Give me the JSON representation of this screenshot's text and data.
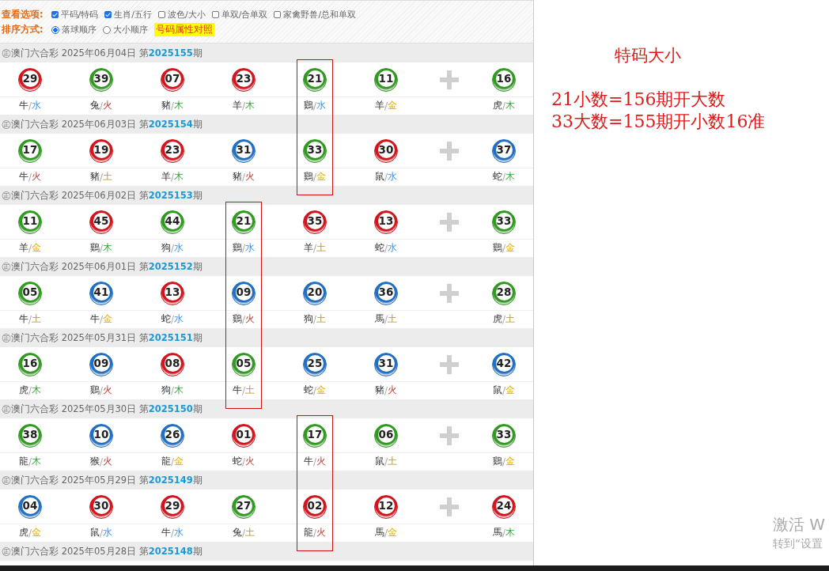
{
  "options": {
    "view_label": "查看选项:",
    "view_options": [
      {
        "label": "平码/特码",
        "checked": true
      },
      {
        "label": "生肖/五行",
        "checked": true
      },
      {
        "label": "波色/大小",
        "checked": false
      },
      {
        "label": "单双/合单双",
        "checked": false
      },
      {
        "label": "家禽野兽/总和单双",
        "checked": false
      }
    ],
    "sort_label": "排序方式:",
    "sort_options": [
      {
        "label": "落球顺序",
        "selected": true
      },
      {
        "label": "大小顺序",
        "selected": false
      }
    ],
    "legend_button": "号码属性对照"
  },
  "draws": [
    {
      "title": "㊣澳门六合彩 2025年06月04日 第**2025155**期",
      "balls": [
        {
          "number": "29",
          "color": "#d4141c",
          "zodiac": "牛",
          "separator": "/",
          "element": {
            "text": "水",
            "kind": "water"
          },
          "boxed": false
        },
        {
          "number": "39",
          "color": "#2e9a1e",
          "zodiac": "兔",
          "separator": "/",
          "element": {
            "text": "火",
            "kind": "fire"
          },
          "boxed": false
        },
        {
          "number": "07",
          "color": "#d4141c",
          "zodiac": "豬",
          "separator": "/",
          "element": {
            "text": "木",
            "kind": "wood"
          },
          "boxed": false
        },
        {
          "number": "23",
          "color": "#d4141c",
          "zodiac": "羊",
          "separator": "/",
          "element": {
            "text": "木",
            "kind": "wood"
          },
          "boxed": false
        },
        {
          "number": "21",
          "color": "#2e9a1e",
          "zodiac": "鷄",
          "separator": "/",
          "element": {
            "text": "水",
            "kind": "water"
          },
          "boxed": true
        },
        {
          "number": "11",
          "color": "#2e9a1e",
          "zodiac": "羊",
          "separator": "/",
          "element": {
            "text": "金",
            "kind": "metal"
          },
          "boxed": false
        }
      ],
      "special": {
        "number": "16",
        "color": "#2e9a1e",
        "zodiac": "虎",
        "separator": "/",
        "element": {
          "text": "木",
          "kind": "wood"
        },
        "boxed": false
      }
    },
    {
      "title": "㊣澳门六合彩 2025年06月03日 第**2025154**期",
      "balls": [
        {
          "number": "17",
          "color": "#2e9a1e",
          "zodiac": "牛",
          "separator": "/",
          "element": {
            "text": "火",
            "kind": "fire"
          },
          "boxed": false
        },
        {
          "number": "19",
          "color": "#d4141c",
          "zodiac": "豬",
          "separator": "/",
          "element": {
            "text": "土",
            "kind": "earth"
          },
          "boxed": false
        },
        {
          "number": "23",
          "color": "#d4141c",
          "zodiac": "羊",
          "separator": "/",
          "element": {
            "text": "木",
            "kind": "wood"
          },
          "boxed": false
        },
        {
          "number": "31",
          "color": "#1f6fc5",
          "zodiac": "豬",
          "separator": "/",
          "element": {
            "text": "火",
            "kind": "fire"
          },
          "boxed": false
        },
        {
          "number": "33",
          "color": "#2e9a1e",
          "zodiac": "鷄",
          "separator": "/",
          "element": {
            "text": "金",
            "kind": "metal"
          },
          "boxed": true
        },
        {
          "number": "30",
          "color": "#d4141c",
          "zodiac": "鼠",
          "separator": "/",
          "element": {
            "text": "水",
            "kind": "water"
          },
          "boxed": false
        }
      ],
      "special": {
        "number": "37",
        "color": "#1f6fc5",
        "zodiac": "蛇",
        "separator": "/",
        "element": {
          "text": "木",
          "kind": "wood"
        },
        "boxed": false
      }
    },
    {
      "title": "㊣澳门六合彩 2025年06月02日 第**2025153**期",
      "balls": [
        {
          "number": "11",
          "color": "#2e9a1e",
          "zodiac": "羊",
          "separator": "/",
          "element": {
            "text": "金",
            "kind": "metal"
          },
          "boxed": false
        },
        {
          "number": "45",
          "color": "#d4141c",
          "zodiac": "鷄",
          "separator": "/",
          "element": {
            "text": "木",
            "kind": "wood"
          },
          "boxed": false
        },
        {
          "number": "44",
          "color": "#2e9a1e",
          "zodiac": "狗",
          "separator": "/",
          "element": {
            "text": "水",
            "kind": "water"
          },
          "boxed": false
        },
        {
          "number": "21",
          "color": "#2e9a1e",
          "zodiac": "鷄",
          "separator": "/",
          "element": {
            "text": "水",
            "kind": "water"
          },
          "boxed": true
        },
        {
          "number": "35",
          "color": "#d4141c",
          "zodiac": "羊",
          "separator": "/",
          "element": {
            "text": "土",
            "kind": "earth"
          },
          "boxed": false
        },
        {
          "number": "13",
          "color": "#d4141c",
          "zodiac": "蛇",
          "separator": "/",
          "element": {
            "text": "水",
            "kind": "water"
          },
          "boxed": false
        }
      ],
      "special": {
        "number": "33",
        "color": "#2e9a1e",
        "zodiac": "鷄",
        "separator": "/",
        "element": {
          "text": "金",
          "kind": "metal"
        },
        "boxed": false
      }
    },
    {
      "title": "㊣澳门六合彩 2025年06月01日 第**2025152**期",
      "balls": [
        {
          "number": "05",
          "color": "#2e9a1e",
          "zodiac": "牛",
          "separator": "/",
          "element": {
            "text": "土",
            "kind": "earth"
          },
          "boxed": false
        },
        {
          "number": "41",
          "color": "#1f6fc5",
          "zodiac": "牛",
          "separator": "/",
          "element": {
            "text": "金",
            "kind": "metal"
          },
          "boxed": false
        },
        {
          "number": "13",
          "color": "#d4141c",
          "zodiac": "蛇",
          "separator": "/",
          "element": {
            "text": "水",
            "kind": "water"
          },
          "boxed": false
        },
        {
          "number": "09",
          "color": "#1f6fc5",
          "zodiac": "鷄",
          "separator": "/",
          "element": {
            "text": "火",
            "kind": "fire"
          },
          "boxed": true
        },
        {
          "number": "20",
          "color": "#1f6fc5",
          "zodiac": "狗",
          "separator": "/",
          "element": {
            "text": "土",
            "kind": "earth"
          },
          "boxed": false
        },
        {
          "number": "36",
          "color": "#1f6fc5",
          "zodiac": "馬",
          "separator": "/",
          "element": {
            "text": "土",
            "kind": "earth"
          },
          "boxed": false
        }
      ],
      "special": {
        "number": "28",
        "color": "#2e9a1e",
        "zodiac": "虎",
        "separator": "/",
        "element": {
          "text": "土",
          "kind": "earth"
        },
        "boxed": false
      }
    },
    {
      "title": "㊣澳门六合彩 2025年05月31日 第**2025151**期",
      "balls": [
        {
          "number": "16",
          "color": "#2e9a1e",
          "zodiac": "虎",
          "separator": "/",
          "element": {
            "text": "木",
            "kind": "wood"
          },
          "boxed": false
        },
        {
          "number": "09",
          "color": "#1f6fc5",
          "zodiac": "鷄",
          "separator": "/",
          "element": {
            "text": "火",
            "kind": "fire"
          },
          "boxed": false
        },
        {
          "number": "08",
          "color": "#d4141c",
          "zodiac": "狗",
          "separator": "/",
          "element": {
            "text": "木",
            "kind": "wood"
          },
          "boxed": false
        },
        {
          "number": "05",
          "color": "#2e9a1e",
          "zodiac": "牛",
          "separator": "/",
          "element": {
            "text": "土",
            "kind": "earth"
          },
          "boxed": true
        },
        {
          "number": "25",
          "color": "#1f6fc5",
          "zodiac": "蛇",
          "separator": "/",
          "element": {
            "text": "金",
            "kind": "metal"
          },
          "boxed": false
        },
        {
          "number": "31",
          "color": "#1f6fc5",
          "zodiac": "豬",
          "separator": "/",
          "element": {
            "text": "火",
            "kind": "fire"
          },
          "boxed": false
        }
      ],
      "special": {
        "number": "42",
        "color": "#1f6fc5",
        "zodiac": "鼠",
        "separator": "/",
        "element": {
          "text": "金",
          "kind": "metal"
        },
        "boxed": false
      }
    },
    {
      "title": "㊣澳门六合彩 2025年05月30日 第**2025150**期",
      "balls": [
        {
          "number": "38",
          "color": "#2e9a1e",
          "zodiac": "龍",
          "separator": "/",
          "element": {
            "text": "木",
            "kind": "wood"
          },
          "boxed": false
        },
        {
          "number": "10",
          "color": "#1f6fc5",
          "zodiac": "猴",
          "separator": "/",
          "element": {
            "text": "火",
            "kind": "fire"
          },
          "boxed": false
        },
        {
          "number": "26",
          "color": "#1f6fc5",
          "zodiac": "龍",
          "separator": "/",
          "element": {
            "text": "金",
            "kind": "metal"
          },
          "boxed": false
        },
        {
          "number": "01",
          "color": "#d4141c",
          "zodiac": "蛇",
          "separator": "/",
          "element": {
            "text": "火",
            "kind": "fire"
          },
          "boxed": false
        },
        {
          "number": "17",
          "color": "#2e9a1e",
          "zodiac": "牛",
          "separator": "/",
          "element": {
            "text": "火",
            "kind": "fire"
          },
          "boxed": true
        },
        {
          "number": "06",
          "color": "#2e9a1e",
          "zodiac": "鼠",
          "separator": "/",
          "element": {
            "text": "土",
            "kind": "earth"
          },
          "boxed": false
        }
      ],
      "special": {
        "number": "33",
        "color": "#2e9a1e",
        "zodiac": "鷄",
        "separator": "/",
        "element": {
          "text": "金",
          "kind": "metal"
        },
        "boxed": false
      }
    },
    {
      "title": "㊣澳门六合彩 2025年05月29日 第**2025149**期",
      "balls": [
        {
          "number": "04",
          "color": "#1f6fc5",
          "zodiac": "虎",
          "separator": "/",
          "element": {
            "text": "金",
            "kind": "metal"
          },
          "boxed": false
        },
        {
          "number": "30",
          "color": "#d4141c",
          "zodiac": "鼠",
          "separator": "/",
          "element": {
            "text": "水",
            "kind": "water"
          },
          "boxed": false
        },
        {
          "number": "29",
          "color": "#d4141c",
          "zodiac": "牛",
          "separator": "/",
          "element": {
            "text": "水",
            "kind": "water"
          },
          "boxed": false
        },
        {
          "number": "27",
          "color": "#2e9a1e",
          "zodiac": "兔",
          "separator": "/",
          "element": {
            "text": "土",
            "kind": "earth"
          },
          "boxed": false
        },
        {
          "number": "02",
          "color": "#d4141c",
          "zodiac": "龍",
          "separator": "/",
          "element": {
            "text": "火",
            "kind": "fire"
          },
          "boxed": true
        },
        {
          "number": "12",
          "color": "#d4141c",
          "zodiac": "馬",
          "separator": "/",
          "element": {
            "text": "金",
            "kind": "metal"
          },
          "boxed": false
        }
      ],
      "special": {
        "number": "24",
        "color": "#d4141c",
        "zodiac": "馬",
        "separator": "/",
        "element": {
          "text": "木",
          "kind": "wood"
        },
        "boxed": false
      }
    },
    {
      "title": "㊣澳门六合彩 2025年05月28日 第**2025148**期"
    }
  ],
  "note": {
    "title": "特码大小",
    "lines": [
      "21小数=156期开大数",
      "33大数=155期开小数16准"
    ]
  },
  "os_watermark": [
    "激活 W",
    "转到“设置"
  ]
}
